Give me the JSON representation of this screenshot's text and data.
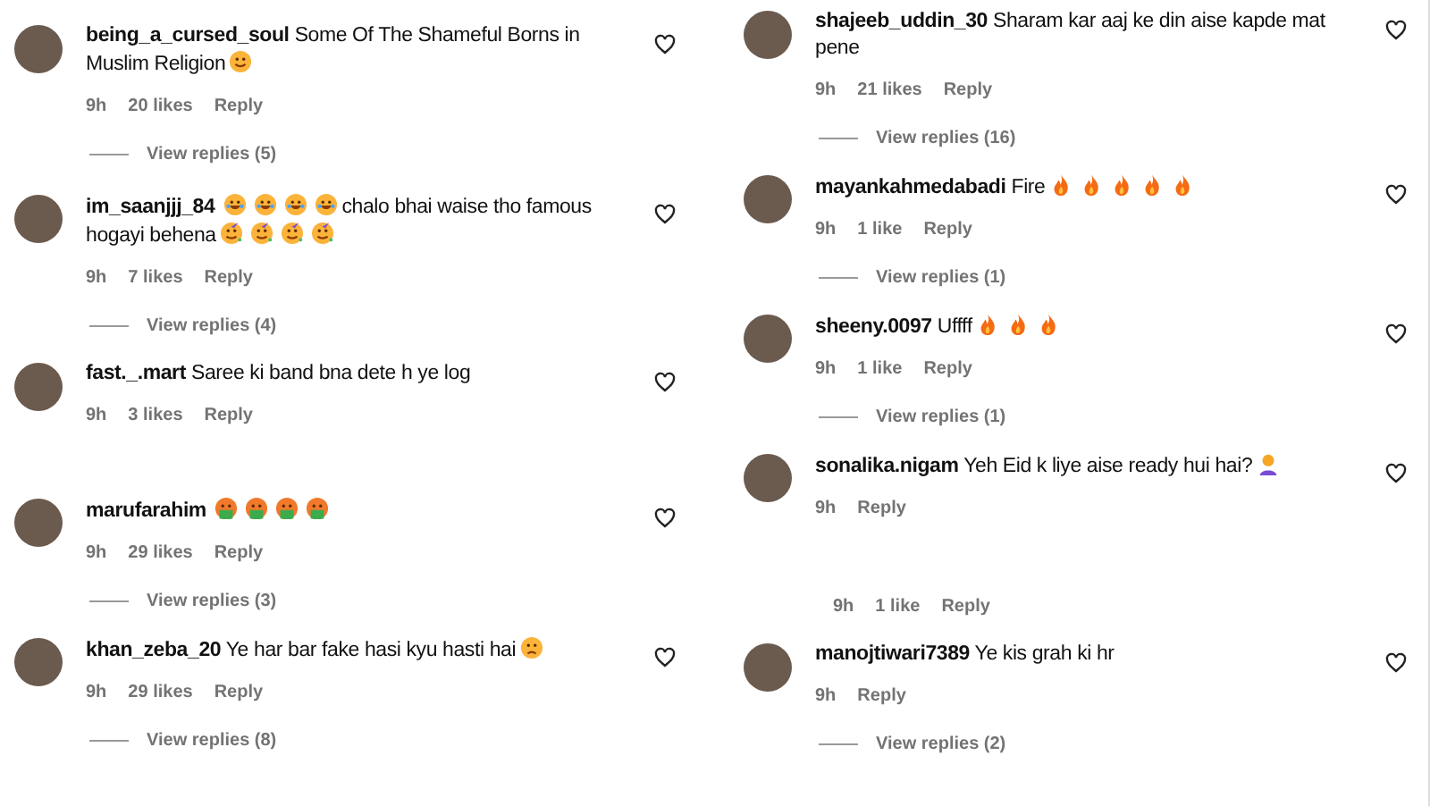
{
  "columns": [
    {
      "items": [
        {
          "kind": "comment",
          "username": "being_a_cursed_soul",
          "parts": [
            {
              "kind": "text",
              "text": "Some Of The Shameful Borns in Muslim Religion"
            },
            {
              "kind": "smile"
            }
          ],
          "time": "9h",
          "likes": "20 likes",
          "reply": "Reply",
          "view_replies": "View replies (5)"
        },
        {
          "kind": "comment",
          "username": "im_saanjjj_84",
          "parts": [
            {
              "kind": "laugh"
            },
            {
              "kind": "laugh"
            },
            {
              "kind": "laugh"
            },
            {
              "kind": "laugh"
            },
            {
              "kind": "text",
              "text": "chalo bhai waise tho famous hogayi behena"
            },
            {
              "kind": "party"
            },
            {
              "kind": "party"
            },
            {
              "kind": "party"
            },
            {
              "kind": "party"
            }
          ],
          "time": "9h",
          "likes": "7 likes",
          "reply": "Reply",
          "view_replies": "View replies (4)"
        },
        {
          "kind": "comment",
          "username": "fast._.mart",
          "parts": [
            {
              "kind": "text",
              "text": "Saree ki band bna dete h ye log"
            }
          ],
          "time": "9h",
          "likes": "3 likes",
          "reply": "Reply"
        },
        {
          "kind": "comment",
          "username": "marufarahim",
          "parts": [
            {
              "kind": "sick"
            },
            {
              "kind": "sick"
            },
            {
              "kind": "sick"
            },
            {
              "kind": "sick"
            }
          ],
          "time": "9h",
          "likes": "29 likes",
          "reply": "Reply",
          "view_replies": "View replies (3)"
        },
        {
          "kind": "comment",
          "username": "khan_zeba_20",
          "parts": [
            {
              "kind": "text",
              "text": "Ye har bar fake hasi kyu hasti hai"
            },
            {
              "kind": "frown"
            }
          ],
          "time": "9h",
          "likes": "29 likes",
          "reply": "Reply",
          "view_replies": "View replies (8)"
        }
      ]
    },
    {
      "items": [
        {
          "kind": "comment",
          "username": "shajeeb_uddin_30",
          "parts": [
            {
              "kind": "text",
              "text": "Sharam kar aaj ke din aise kapde mat pene"
            }
          ],
          "time": "9h",
          "likes": "21 likes",
          "reply": "Reply",
          "view_replies": "View replies (16)"
        },
        {
          "kind": "comment",
          "username": "mayankahmedabadi",
          "parts": [
            {
              "kind": "text",
              "text": "Fire"
            },
            {
              "kind": "fire"
            },
            {
              "kind": "fire"
            },
            {
              "kind": "fire"
            },
            {
              "kind": "fire"
            },
            {
              "kind": "fire"
            }
          ],
          "time": "9h",
          "likes": "1 like",
          "reply": "Reply",
          "view_replies": "View replies (1)"
        },
        {
          "kind": "comment",
          "username": "sheeny.0097",
          "parts": [
            {
              "kind": "text",
              "text": "Uffff"
            },
            {
              "kind": "fire"
            },
            {
              "kind": "fire"
            },
            {
              "kind": "fire"
            }
          ],
          "time": "9h",
          "likes": "1 like",
          "reply": "Reply",
          "view_replies": "View replies (1)"
        },
        {
          "kind": "comment",
          "username": "sonalika.nigam",
          "parts": [
            {
              "kind": "text",
              "text": "Yeh Eid k liye aise ready hui hai?"
            },
            {
              "kind": "person"
            }
          ],
          "time": "9h",
          "reply": "Reply"
        },
        {
          "kind": "meta",
          "time": "9h",
          "likes": "1 like",
          "reply": "Reply"
        },
        {
          "kind": "comment",
          "username": "manojtiwari7389",
          "parts": [
            {
              "kind": "text",
              "text": "Ye kis grah ki hr"
            }
          ],
          "time": "9h",
          "reply": "Reply",
          "view_replies": "View replies (2)"
        }
      ]
    }
  ]
}
